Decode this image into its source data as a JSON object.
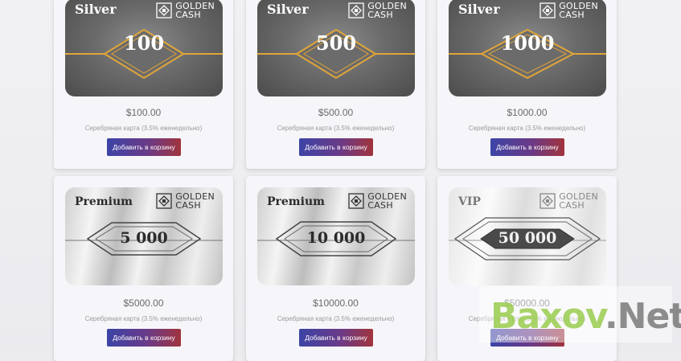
{
  "brand": {
    "line1": "GOLDEN",
    "line2": "CASH"
  },
  "products": [
    {
      "tier": "Silver",
      "card_value": "100",
      "price": "$100.00",
      "description": "Серебряная карта (3.5% еженедельно)",
      "button": "Добавить в корзину"
    },
    {
      "tier": "Silver",
      "card_value": "500",
      "price": "$500.00",
      "description": "Серебряная карта (3.5% еженедельно)",
      "button": "Добавить в корзину"
    },
    {
      "tier": "Silver",
      "card_value": "1000",
      "price": "$1000.00",
      "description": "Серебряная карта (3.5% еженедельно)",
      "button": "Добавить в корзину"
    },
    {
      "tier": "Premium",
      "card_value": "5 000",
      "price": "$5000.00",
      "description": "Серебряная карта (3.5% еженедельно)",
      "button": "Добавить в корзину"
    },
    {
      "tier": "Premium",
      "card_value": "10 000",
      "price": "$10000.00",
      "description": "Серебряная карта (3.5% еженедельно)",
      "button": "Добавить в корзину"
    },
    {
      "tier": "VIP",
      "card_value": "50 000",
      "price": "$50000.00",
      "description": "Серебряная карта (3.5% еженедельно)",
      "button": "Добавить в корзину"
    }
  ],
  "watermark": {
    "part1": "Baxov",
    "part2": ".Net"
  },
  "colors": {
    "button_start": "#3c44a6",
    "button_end": "#a1343d",
    "gold_frame": "#e0a53a",
    "price_text": "#6a6a6a"
  }
}
